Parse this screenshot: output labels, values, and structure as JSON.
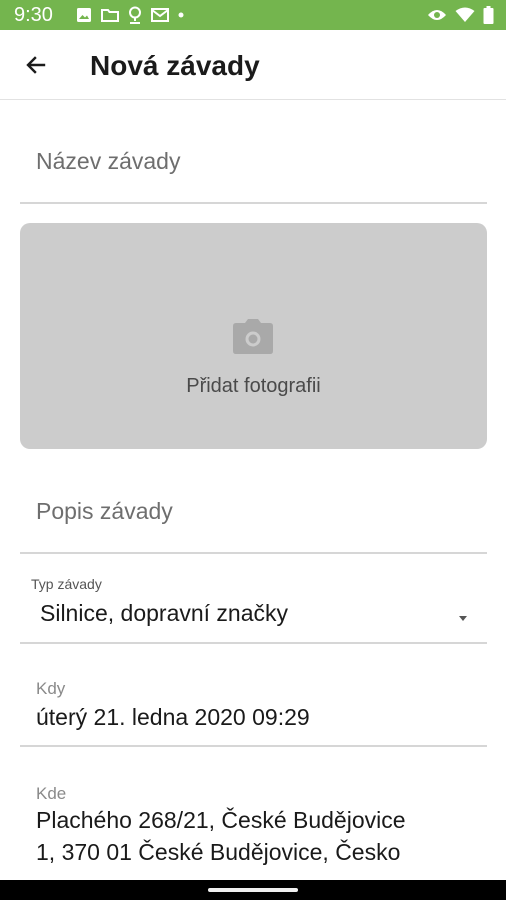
{
  "status_bar": {
    "time": "9:30",
    "left_icons": [
      "image-icon",
      "folder-icon",
      "location-icon",
      "mail-icon",
      "dot-icon"
    ],
    "right_icons": [
      "eye-icon",
      "wifi-icon",
      "battery-icon"
    ],
    "background": "#74b54e"
  },
  "app_bar": {
    "back_icon": "arrow-left-icon",
    "title": "Nová závady"
  },
  "form": {
    "title_field": {
      "placeholder": "Název závady",
      "value": ""
    },
    "photo": {
      "icon": "camera-icon",
      "label": "Přidat fotografii"
    },
    "description_field": {
      "placeholder": "Popis závady",
      "value": ""
    },
    "type": {
      "label": "Typ závady",
      "value": "Silnice, dopravní značky"
    },
    "when": {
      "label": "Kdy",
      "value": "úterý 21. ledna 2020 09:29"
    },
    "where": {
      "label": "Kde",
      "line1": "Plachého 268/21, České Budějovice",
      "line2": "1, 370 01 České Budějovice, Česko"
    }
  }
}
